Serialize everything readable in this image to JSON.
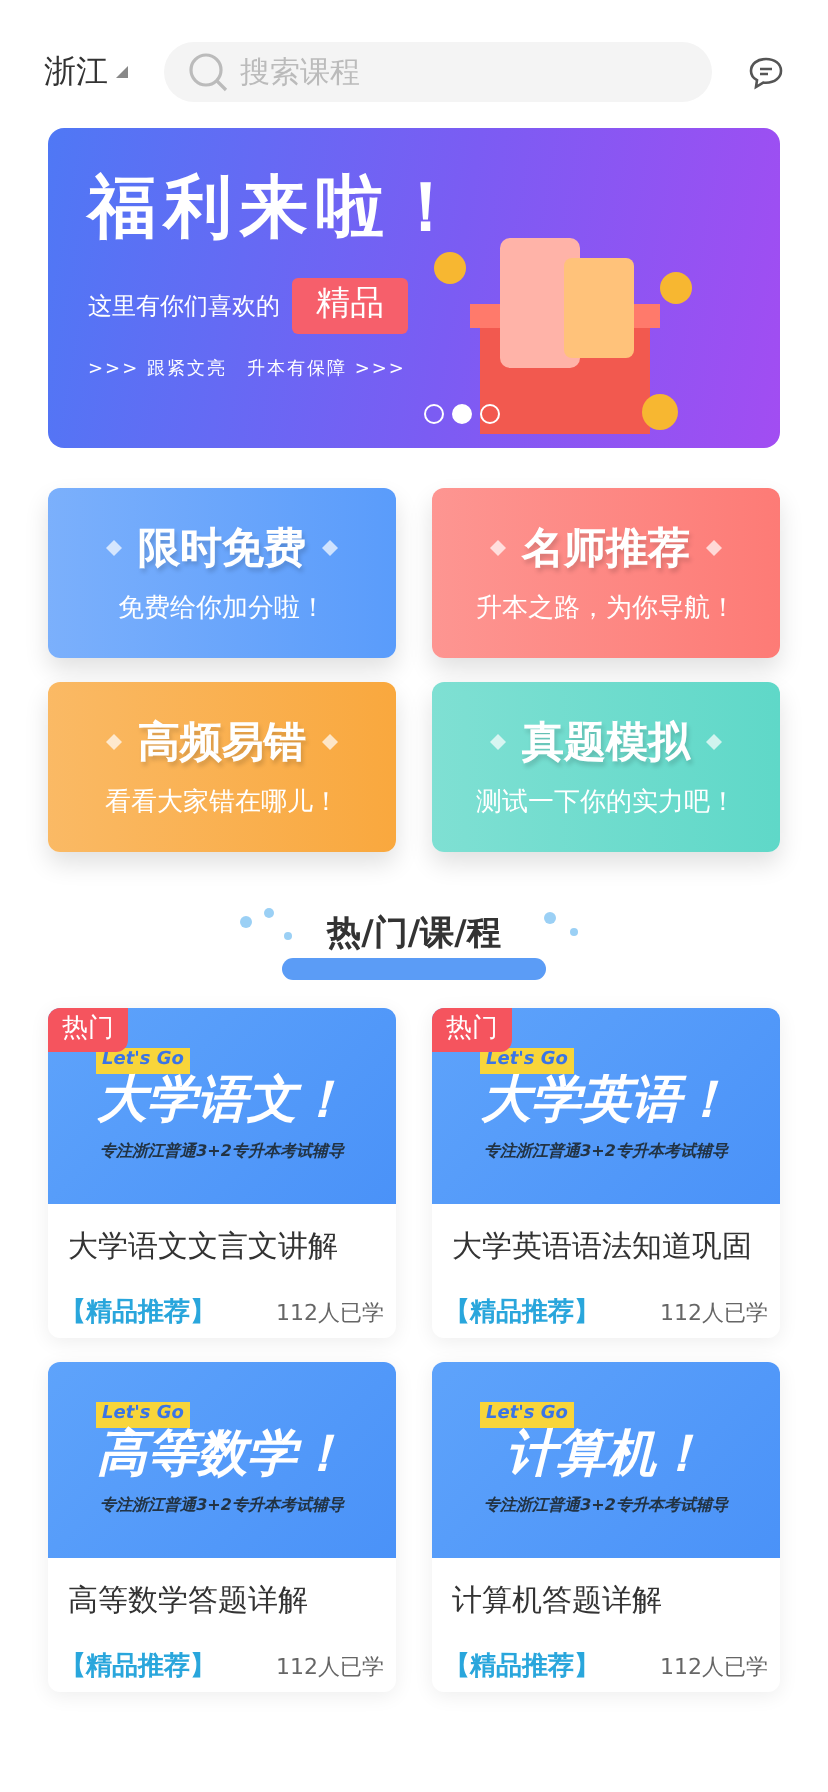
{
  "header": {
    "location": "浙江",
    "search": {
      "placeholder": "搜索课程"
    }
  },
  "banner": {
    "title": "福利来啦！",
    "subtitle": "这里有你们喜欢的",
    "highlight": "精品",
    "slogan": ">>> 跟紧文亮　升本有保障 >>>",
    "dots": [
      {
        "selected": false
      },
      {
        "selected": true
      },
      {
        "selected": false
      }
    ]
  },
  "features": [
    {
      "title": "限时免费",
      "subtitle": "免费给你加分啦！",
      "color": "#5a9cfb"
    },
    {
      "title": "名师推荐",
      "subtitle": "升本之路，为你导航！",
      "color": "#fd7b76"
    },
    {
      "title": "高频易错",
      "subtitle": "看看大家错在哪儿！",
      "color": "#f9a83e"
    },
    {
      "title": "真题模拟",
      "subtitle": "测试一下你的实力吧！",
      "color": "#5fd8c8"
    }
  ],
  "section_title": "热/门/课/程",
  "courses": [
    {
      "hot": true,
      "tag": "热门",
      "cover_badge": "Let's Go",
      "cover_title": "大学语文！",
      "cover_caption": "专注浙江普通3+2专升本考试辅导",
      "title": "大学语文文言文讲解",
      "label": "【精品推荐】",
      "learners": "112人已学"
    },
    {
      "hot": true,
      "tag": "热门",
      "cover_badge": "Let's Go",
      "cover_title": "大学英语！",
      "cover_caption": "专注浙江普通3+2专升本考试辅导",
      "title": "大学英语语法知道巩固",
      "label": "【精品推荐】",
      "learners": "112人已学"
    },
    {
      "hot": false,
      "cover_badge": "Let's Go",
      "cover_title": "高等数学！",
      "cover_caption": "专注浙江普通3+2专升本考试辅导",
      "title": "高等数学答题详解",
      "label": "【精品推荐】",
      "learners": "112人已学"
    },
    {
      "hot": false,
      "cover_badge": "Let's Go",
      "cover_title": "计算机！",
      "cover_caption": "专注浙江普通3+2专升本考试辅导",
      "title": "计算机答题详解",
      "label": "【精品推荐】",
      "learners": "112人已学"
    }
  ]
}
